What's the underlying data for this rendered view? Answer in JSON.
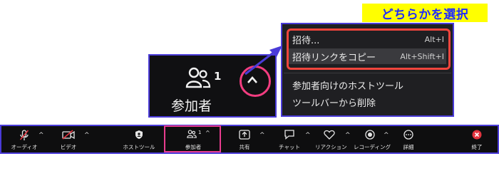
{
  "callout": {
    "label": "どちらかを選択"
  },
  "zoom": {
    "participants_count": "1",
    "participants_label": "参加者"
  },
  "menu": {
    "items": [
      {
        "label": "招待...",
        "shortcut": "Alt+I"
      },
      {
        "label": "招待リンクをコピー",
        "shortcut": "Alt+Shift+I"
      },
      {
        "label": "参加者向けのホストツール",
        "shortcut": ""
      },
      {
        "label": "ツールバーから削除",
        "shortcut": ""
      }
    ]
  },
  "toolbar": {
    "audio": "オーディオ",
    "video": "ビデオ",
    "host_tools": "ホストツール",
    "participants": "参加者",
    "participants_count": "1",
    "share": "共有",
    "chat": "チャット",
    "reactions": "リアクション",
    "recording": "レコーディング",
    "details": "詳細",
    "end": "終了"
  },
  "colors": {
    "accent_blue": "#4a3bd8",
    "highlight_pink": "#e83c8e",
    "highlight_red": "#f2453d",
    "callout_yellow": "#ffff00",
    "callout_text": "#1f2bff"
  }
}
